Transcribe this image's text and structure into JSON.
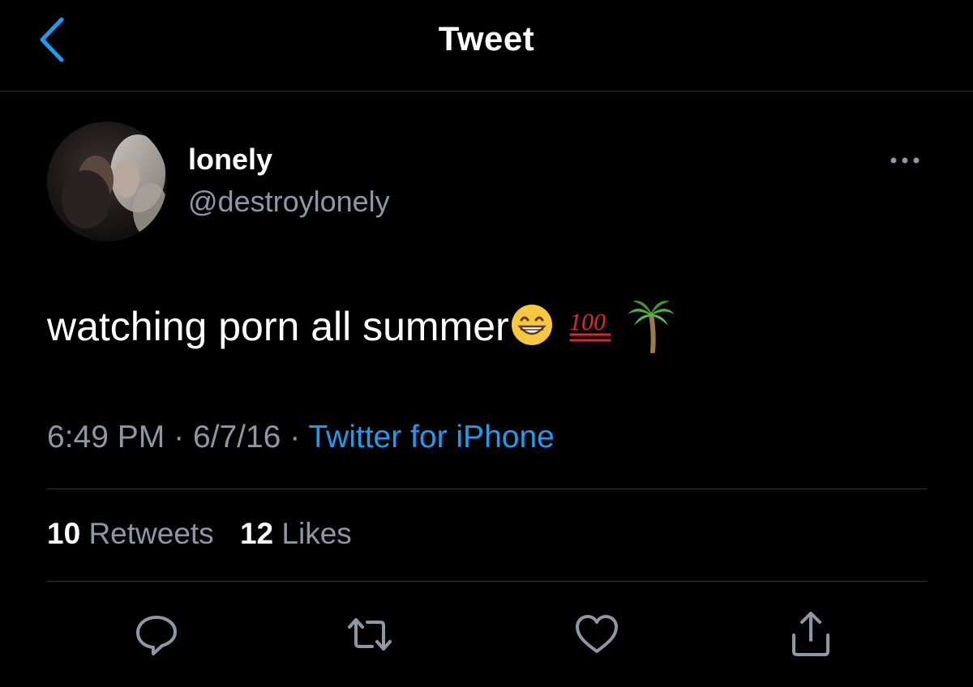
{
  "header": {
    "title": "Tweet",
    "back_icon": "chevron-left-icon"
  },
  "author": {
    "display_name": "lonely",
    "handle": "@destroylonely",
    "avatar": "avatar-photo"
  },
  "tweet": {
    "text": "watching porn all summer",
    "emojis": [
      "grinning-face-with-smiling-eyes-emoji",
      "hundred-points-emoji",
      "palm-tree-emoji"
    ]
  },
  "meta": {
    "time": "6:49 PM",
    "separator": "·",
    "date": "6/7/16",
    "source": "Twitter for iPhone"
  },
  "stats": {
    "retweets_count": "10",
    "retweets_label": "Retweets",
    "likes_count": "12",
    "likes_label": "Likes"
  },
  "actions": [
    "reply-icon",
    "retweet-icon",
    "like-icon",
    "share-icon"
  ],
  "colors": {
    "background": "#000000",
    "accent": "#1d9bf0",
    "secondary_text": "#8b98a5",
    "primary_text": "#ffffff",
    "divider": "#2f3336"
  }
}
